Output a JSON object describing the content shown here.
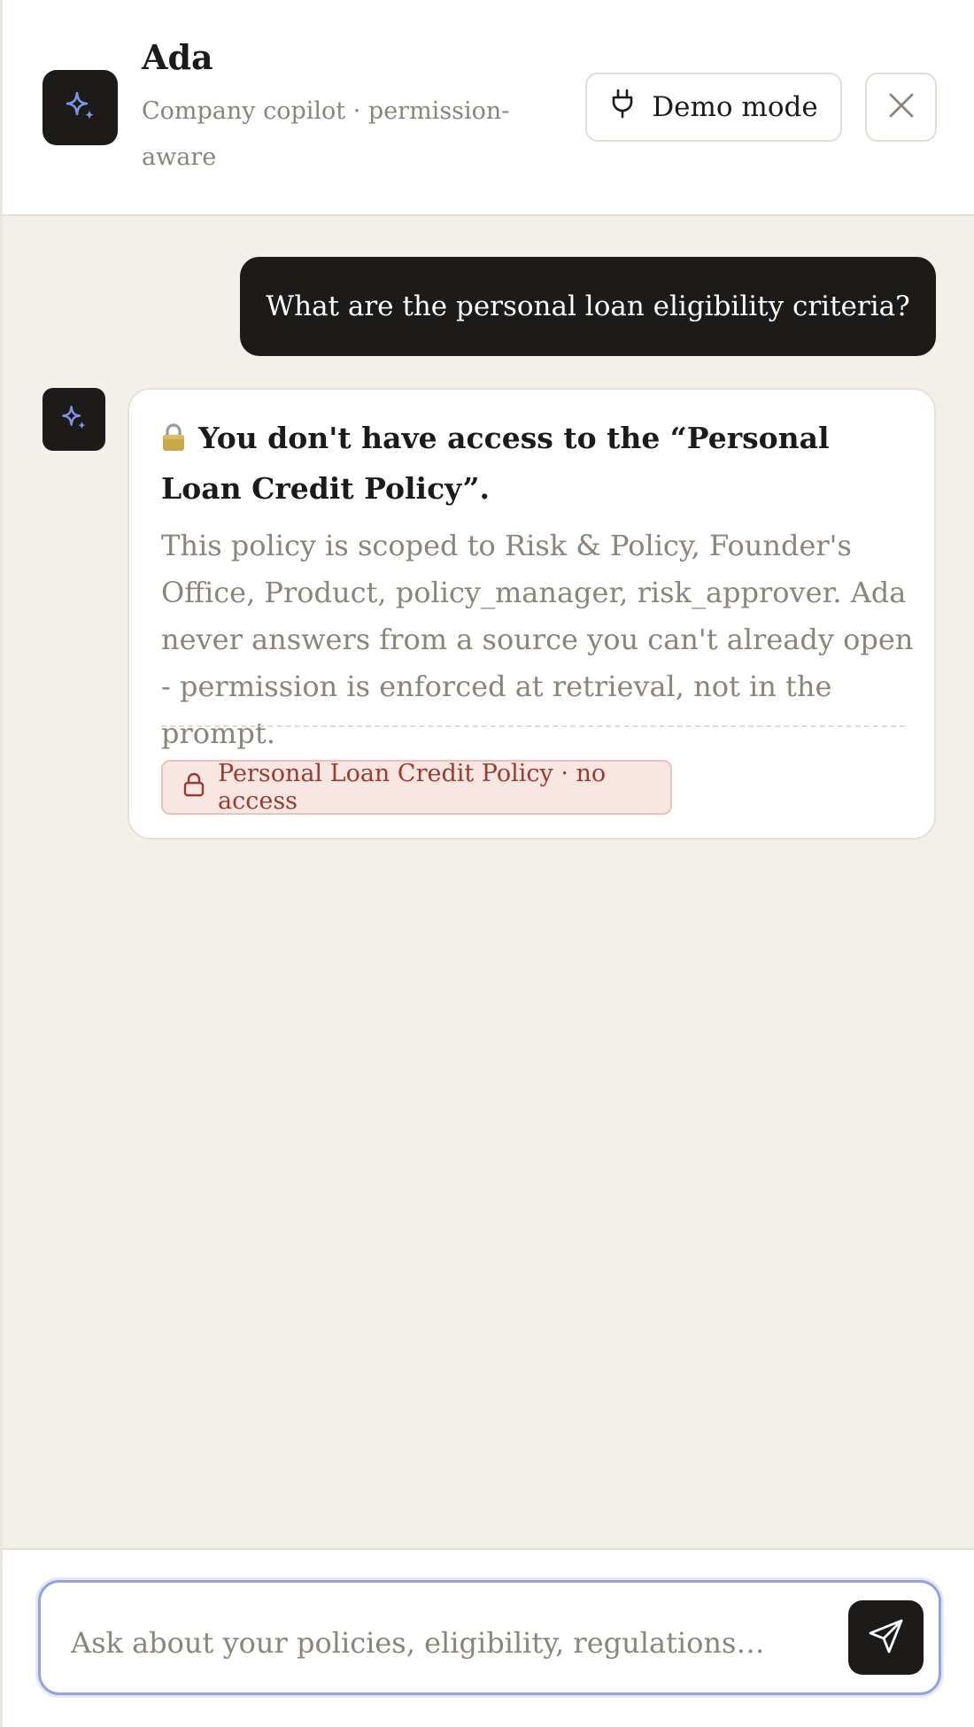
{
  "header": {
    "title": "Ada",
    "subtitle": "Company copilot · permission-aware",
    "demo_mode_label": "Demo mode",
    "logo_icon": "sparkles-icon",
    "demo_icon": "plug-icon",
    "close_icon": "close-icon"
  },
  "conversation": {
    "user_message": "What are the personal loan eligibility criteria?",
    "assistant": {
      "avatar_icon": "sparkles-icon",
      "heading_icon": "lock-emoji-icon",
      "heading": "You don't have access to the “Personal Loan Credit Policy”.",
      "body": "This policy is scoped to Risk & Policy, Founder's Office, Product, policy_manager, risk_approver. Ada never answers from a source you can't already open - permission is enforced at retrieval, not in the prompt.",
      "source_chip": {
        "icon": "lock-icon",
        "label": "Personal Loan Credit Policy · no access"
      }
    }
  },
  "composer": {
    "value": "",
    "placeholder": "Ask about your policies, eligibility, regulations…",
    "send_icon": "send-icon"
  },
  "colors": {
    "ink": "#1c1b19",
    "muted": "#8a857b",
    "canvas": "#f3f0ea",
    "accent_icon": "#7f95e6",
    "denied_bg": "#f8e6e3",
    "denied_text": "#9b3a30",
    "focus_ring": "#8fa4e0"
  }
}
